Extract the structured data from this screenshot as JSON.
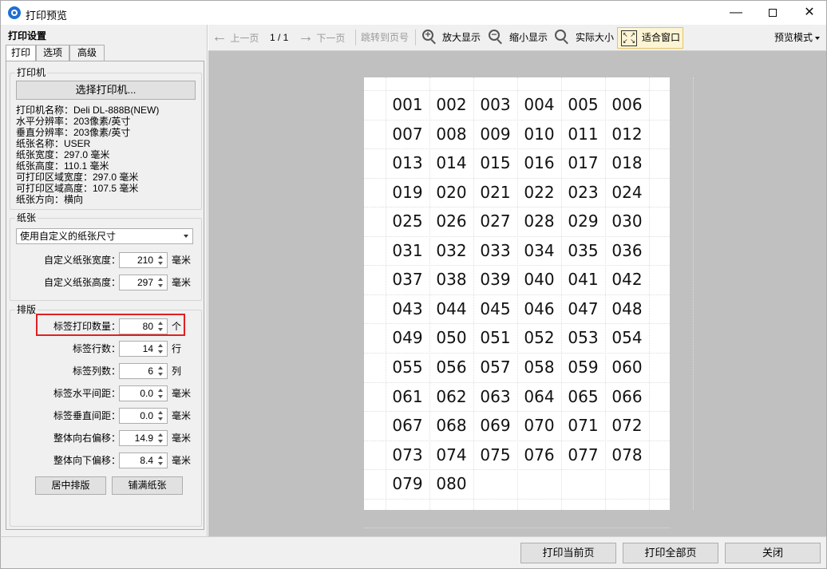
{
  "window": {
    "title": "打印预览",
    "minimize_symbol": "—",
    "close_symbol": "✕"
  },
  "settings": {
    "title": "打印设置",
    "tabs": [
      {
        "label": "打印",
        "active": true
      },
      {
        "label": "选项",
        "active": false
      },
      {
        "label": "高级",
        "active": false
      }
    ],
    "printer_group": {
      "label": "打印机",
      "select_button": "选择打印机...",
      "info": [
        "打印机名称：Deli DL-888B(NEW)",
        "水平分辨率：203像素/英寸",
        "垂直分辨率：203像素/英寸",
        "纸张名称：USER",
        "纸张宽度：297.0 毫米",
        "纸张高度：110.1 毫米",
        "可打印区域宽度：297.0 毫米",
        "可打印区域高度：107.5 毫米",
        "纸张方向：横向"
      ]
    },
    "paper_group": {
      "label": "纸张",
      "size_select": "使用自定义的纸张尺寸",
      "fields": [
        {
          "label": "自定义纸张宽度：",
          "value": "210",
          "unit": "毫米"
        },
        {
          "label": "自定义纸张高度：",
          "value": "297",
          "unit": "毫米"
        }
      ]
    },
    "layout_group": {
      "label": "排版",
      "fields": [
        {
          "label": "标签打印数量：",
          "value": "80",
          "unit": "个"
        },
        {
          "label": "标签行数：",
          "value": "14",
          "unit": "行"
        },
        {
          "label": "标签列数：",
          "value": "6",
          "unit": "列"
        },
        {
          "label": "标签水平间距：",
          "value": "0.0",
          "unit": "毫米"
        },
        {
          "label": "标签垂直间距：",
          "value": "0.0",
          "unit": "毫米"
        },
        {
          "label": "整体向右偏移：",
          "value": "14.9",
          "unit": "毫米"
        },
        {
          "label": "整体向下偏移：",
          "value": "8.4",
          "unit": "毫米"
        }
      ],
      "center_button": "居中排版",
      "fill_button": "铺满纸张"
    }
  },
  "toolbar": {
    "prev_page": "上一页",
    "page_indicator": "1 / 1",
    "next_page": "下一页",
    "goto_page": "跳转到页号",
    "zoom_in": "放大显示",
    "zoom_out": "缩小显示",
    "actual_size": "实际大小",
    "fit_window": "适合窗口",
    "preview_mode": "预览模式"
  },
  "preview": {
    "columns": 6,
    "labels": [
      "001",
      "002",
      "003",
      "004",
      "005",
      "006",
      "007",
      "008",
      "009",
      "010",
      "011",
      "012",
      "013",
      "014",
      "015",
      "016",
      "017",
      "018",
      "019",
      "020",
      "021",
      "022",
      "023",
      "024",
      "025",
      "026",
      "027",
      "028",
      "029",
      "030",
      "031",
      "032",
      "033",
      "034",
      "035",
      "036",
      "037",
      "038",
      "039",
      "040",
      "041",
      "042",
      "043",
      "044",
      "045",
      "046",
      "047",
      "048",
      "049",
      "050",
      "051",
      "052",
      "053",
      "054",
      "055",
      "056",
      "057",
      "058",
      "059",
      "060",
      "061",
      "062",
      "063",
      "064",
      "065",
      "066",
      "067",
      "068",
      "069",
      "070",
      "071",
      "072",
      "073",
      "074",
      "075",
      "076",
      "077",
      "078",
      "079",
      "080"
    ]
  },
  "footer": {
    "print_current": "打印当前页",
    "print_all": "打印全部页",
    "close": "关闭"
  }
}
